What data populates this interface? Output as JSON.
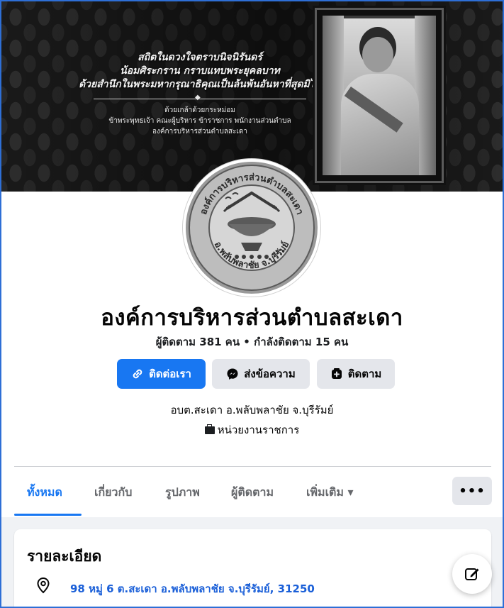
{
  "cover": {
    "line1": "สถิตในดวงใจตราบนิจนิรันดร์",
    "line2": "น้อมศิระกราน กราบแทบพระยุคลบาท",
    "line3": "ด้วยสำนึกในพระมหากรุณาธิคุณเป็นล้นพ้นอันหาที่สุดมิได้",
    "sub1": "ด้วยเกล้าด้วยกระหม่อม",
    "sub2": "ข้าพระพุทธเจ้า คณะผู้บริหาร ข้าราชการ พนักงานส่วนตำบล",
    "sub3": "องค์การบริหารส่วนตำบลสะเดา"
  },
  "logo": {
    "ring_top": "องค์การบริหารส่วนตำบลสะเดา",
    "ring_bottom": "อ.พลับพลาชัย จ.บุรีรัมย์"
  },
  "page": {
    "name": "องค์การบริหารส่วนตำบลสะเดา",
    "follow_stats": "ผู้ติดตาม 381 คน • กำลังติดตาม 15 คน",
    "intro": "อบต.สะเดา อ.พลับพลาชัย จ.บุรีรัมย์",
    "category": "หน่วยงานราชการ"
  },
  "buttons": {
    "contact": "ติดต่อเรา",
    "message": "ส่งข้อความ",
    "follow": "ติดตาม",
    "more": "•••"
  },
  "tabs": [
    {
      "label": "ทั้งหมด"
    },
    {
      "label": "เกี่ยวกับ"
    },
    {
      "label": "รูปภาพ"
    },
    {
      "label": "ผู้ติดตาม"
    },
    {
      "label": "เพิ่มเติม ▾"
    }
  ],
  "details": {
    "title": "รายละเอียด",
    "address": "98 หมู่ 6 ต.สะเดา อ.พลับพลาชัย จ.บุรีรัมย์, 31250"
  },
  "colors": {
    "accent": "#1877f2",
    "secondary_button": "#e4e6eb",
    "frame_border": "#2e6fd6"
  }
}
